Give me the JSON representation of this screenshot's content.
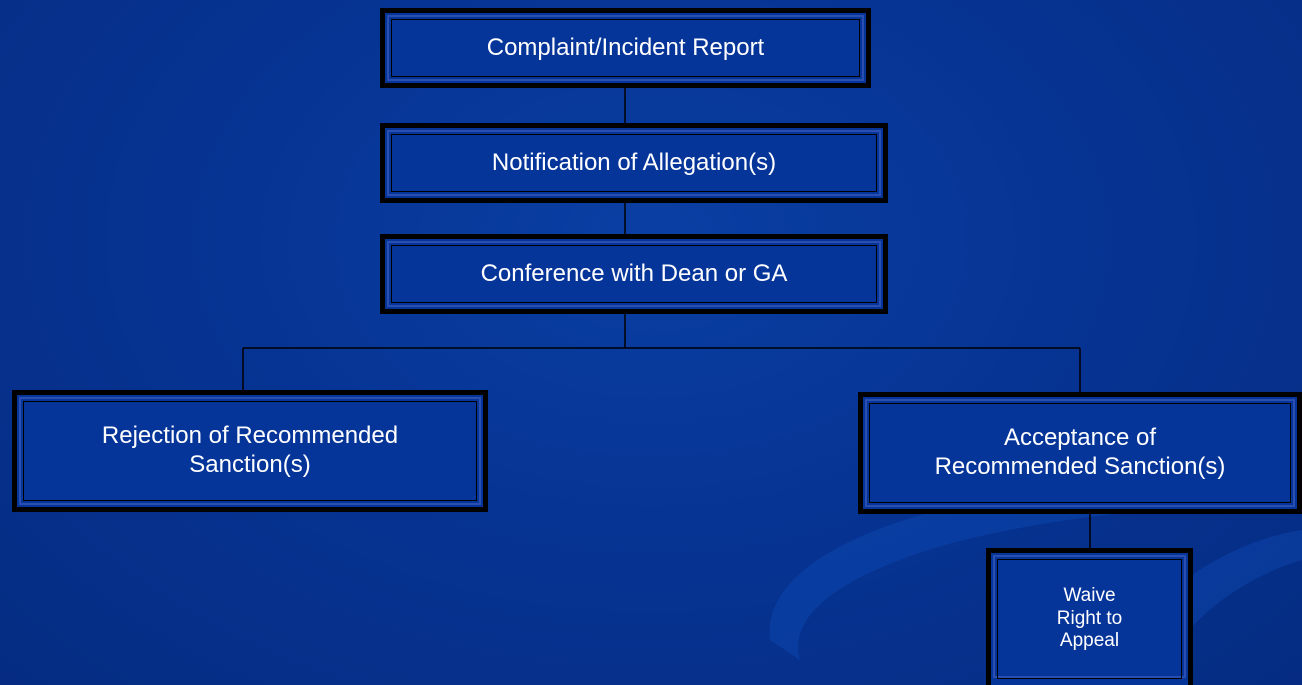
{
  "theme": {
    "background": "#063494",
    "box_fill": "#06359a",
    "box_border": "#000000",
    "text_color": "#ffffff",
    "line_color": "#000000"
  },
  "nodes": {
    "complaint": "Complaint/Incident Report",
    "notification": "Notification of Allegation(s)",
    "conference": "Conference with Dean or GA",
    "rejection_line1": "Rejection of Recommended",
    "rejection_line2": "Sanction(s)",
    "acceptance_line1": "Acceptance of",
    "acceptance_line2": "Recommended Sanction(s)",
    "waive_line1": "Waive",
    "waive_line2": "Right to",
    "waive_line3": "Appeal"
  },
  "edges": [
    [
      "complaint",
      "notification"
    ],
    [
      "notification",
      "conference"
    ],
    [
      "conference",
      "rejection"
    ],
    [
      "conference",
      "acceptance"
    ],
    [
      "acceptance",
      "waive"
    ]
  ]
}
